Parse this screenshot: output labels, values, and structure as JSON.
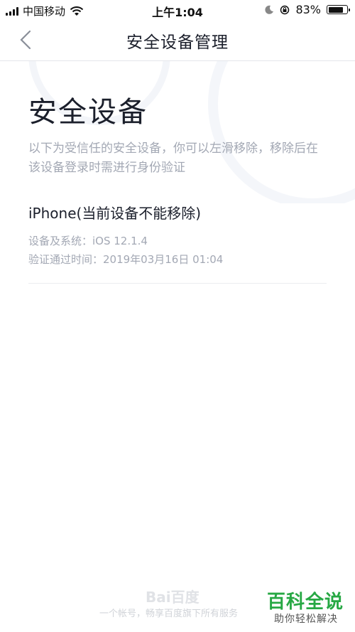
{
  "status_bar": {
    "carrier": "中国移动",
    "time": "上午1:04",
    "battery": "83%",
    "battery_level": 0.83
  },
  "nav": {
    "title": "安全设备管理",
    "back_icon": "chevron-left-icon"
  },
  "main": {
    "heading": "安全设备",
    "description": "以下为受信任的安全设备，你可以左滑移除，移除后在该设备登录时需进行身份验证",
    "devices": [
      {
        "name": "iPhone(当前设备不能移除)",
        "system": "设备及系统：iOS 12.1.4",
        "verified_time": "验证通过时间：2019年03月16日 01:04"
      }
    ]
  },
  "footer": {
    "logo": "Bai百度",
    "slogan": "一个帐号，畅享百度旗下所有服务"
  },
  "watermark": {
    "title": "百科全说",
    "subtitle": "助你轻松解决"
  }
}
